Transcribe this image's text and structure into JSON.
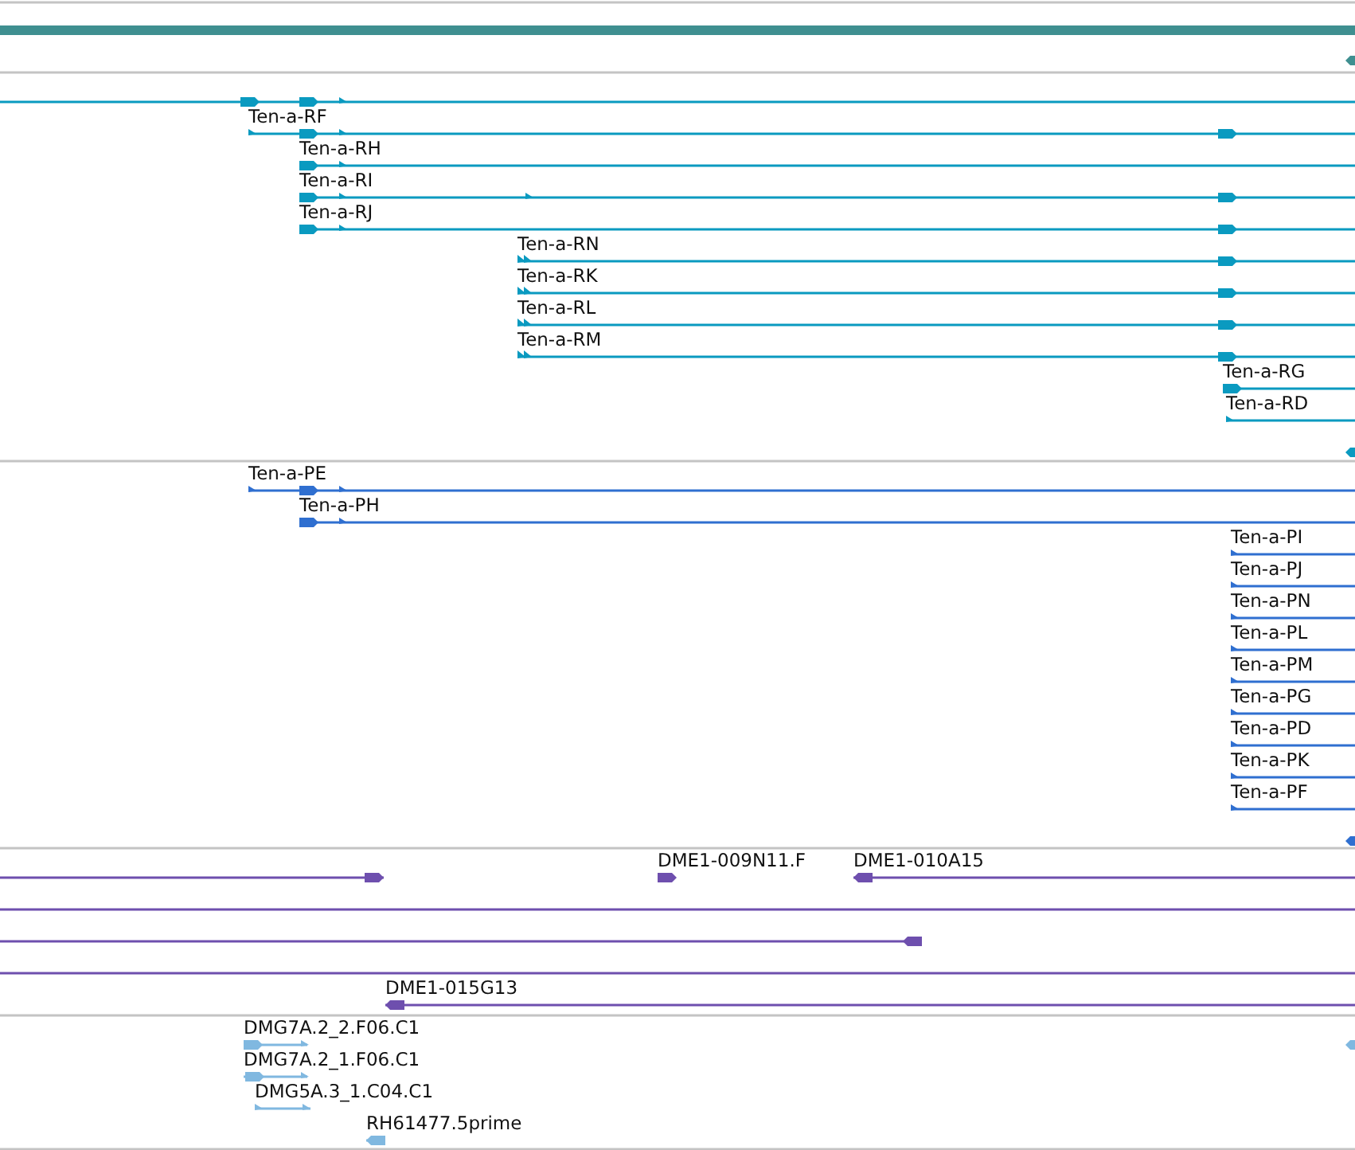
{
  "tracks": [
    {
      "kind": "overview",
      "color": "#3f8f90",
      "features": [
        {
          "reverse": true
        }
      ]
    },
    {
      "kind": "transcripts",
      "color": "#0a9ac0",
      "features": [
        {
          "reverse": false
        },
        {
          "label": "Ten-a-RF",
          "reverse": false
        },
        {
          "label": "Ten-a-RH",
          "reverse": false
        },
        {
          "label": "Ten-a-RI",
          "reverse": false
        },
        {
          "label": "Ten-a-RJ",
          "reverse": false
        },
        {
          "label": "Ten-a-RN",
          "reverse": false
        },
        {
          "label": "Ten-a-RK",
          "reverse": false
        },
        {
          "label": "Ten-a-RL",
          "reverse": false
        },
        {
          "label": "Ten-a-RM",
          "reverse": false
        },
        {
          "label": "Ten-a-RG",
          "reverse": false
        },
        {
          "label": "Ten-a-RD",
          "reverse": false
        },
        {
          "reverse": true
        }
      ]
    },
    {
      "kind": "transcripts",
      "color": "#2f6fd0",
      "features": [
        {
          "label": "Ten-a-PE",
          "reverse": false
        },
        {
          "label": "Ten-a-PH",
          "reverse": false
        },
        {
          "label": "Ten-a-PI",
          "reverse": false
        },
        {
          "label": "Ten-a-PJ",
          "reverse": false
        },
        {
          "label": "Ten-a-PN",
          "reverse": false
        },
        {
          "label": "Ten-a-PL",
          "reverse": false
        },
        {
          "label": "Ten-a-PM",
          "reverse": false
        },
        {
          "label": "Ten-a-PG",
          "reverse": false
        },
        {
          "label": "Ten-a-PD",
          "reverse": false
        },
        {
          "label": "Ten-a-PK",
          "reverse": false
        },
        {
          "label": "Ten-a-PF",
          "reverse": false
        },
        {
          "reverse": true
        }
      ]
    },
    {
      "kind": "clones",
      "color": "#6e4fae",
      "features": [
        {
          "kind": "arrowed",
          "reverse": false
        },
        {
          "kind": "arrowed",
          "label": "DME1-009N11.F",
          "reverse": false
        },
        {
          "kind": "arrowed",
          "label": "DME1-010A15",
          "reverse": true
        },
        {
          "kind": "line"
        },
        {
          "kind": "arrowed",
          "reverse": true
        },
        {
          "kind": "line"
        },
        {
          "kind": "arrowed",
          "label": "DME1-015G13",
          "reverse": true
        }
      ]
    },
    {
      "kind": "ests",
      "color": "#80b8e0",
      "features": [
        {
          "label": "DMG7A.2_2.F06.C1",
          "reverse": false
        },
        {
          "label": "DMG7A.2_1.F06.C1",
          "reverse": false
        },
        {
          "label": "DMG5A.3_1.C04.C1",
          "reverse": false
        },
        {
          "label": "RH61477.5prime",
          "reverse": true
        },
        {
          "reverse": true
        }
      ]
    }
  ]
}
